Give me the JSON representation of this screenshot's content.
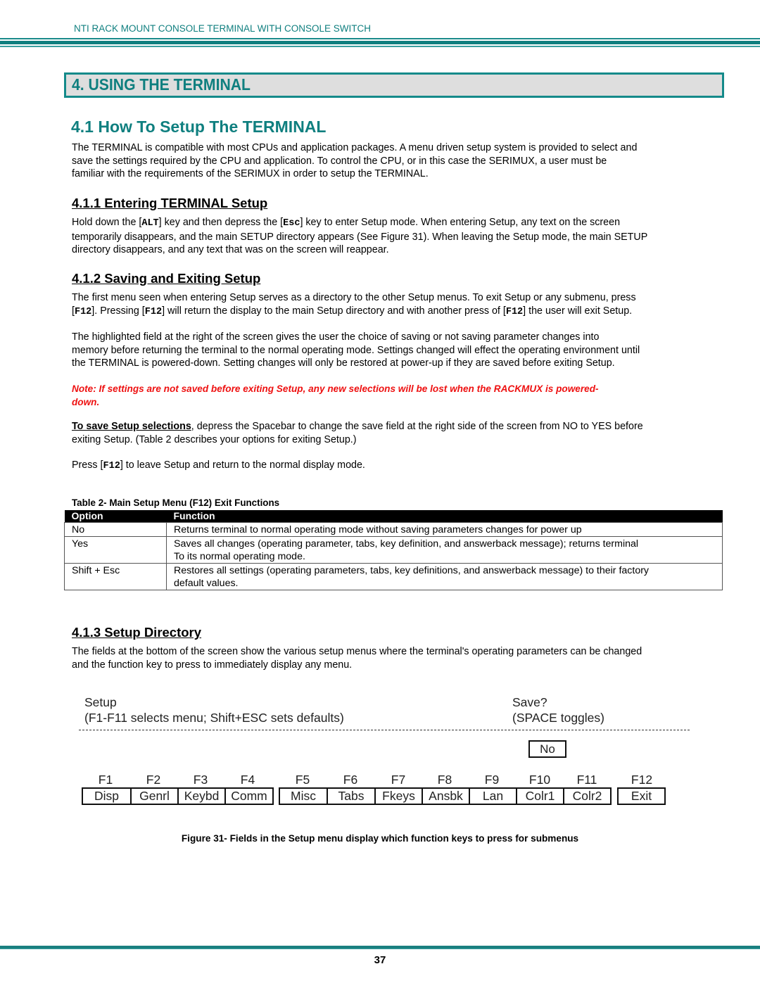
{
  "running_header": "NTI RACK MOUNT CONSOLE TERMINAL WITH CONSOLE SWITCH",
  "chapter_title": "4. USING THE TERMINAL",
  "section_4_1": {
    "title": "4.1 How To Setup The TERMINAL",
    "body": [
      "The TERMINAL is compatible with most CPUs and application packages. A menu driven setup system is provided to select and",
      "save the settings required by the CPU and application.   To control the CPU,  or in this case the SERIMUX, a user must be",
      "familiar with the requirements of the SERIMUX in order to setup the TERMINAL."
    ]
  },
  "section_4_1_1": {
    "title": "4.1.1 Entering TERMINAL Setup",
    "line1_a": "Hold down the [",
    "key_alt": "ALT",
    "line1_b": "] key and then depress the [",
    "key_esc": "Esc",
    "line1_c": "] key to enter Setup mode.  When entering Setup, any text on the screen",
    "line2": "temporarily disappears, and the main SETUP directory appears (See Figure 31). When leaving the Setup mode, the main SETUP",
    "line3": "directory disappears, and any text that was on the screen will reappear."
  },
  "section_4_1_2": {
    "title": "4.1.2 Saving and Exiting Setup",
    "p1_line1": "The first menu seen when entering Setup serves as a directory to the other Setup menus. To exit Setup or any submenu, press",
    "key_f12": "F12",
    "p1_line2_a": "[",
    "p1_line2_b": "].   Pressing [",
    "p1_line2_c": "] will return the display to the main Setup directory and with another press of [",
    "p1_line2_d": "] the user will exit  Setup.",
    "p2": [
      "The highlighted field at the right of the screen gives the user the choice of saving or not saving parameter changes into",
      "memory before returning the terminal to the normal operating mode.    Settings changed will effect the operating environment until",
      "the TERMINAL is powered-down. Setting changes will only be restored at power-up if  they are saved before exiting Setup."
    ],
    "note": [
      "Note:  If settings are not saved before exiting Setup, any new selections will be lost when the RACKMUX is powered-",
      "down."
    ],
    "save_lead": "To save Setup selections",
    "save_rest_line1": ", depress the Spacebar to change the save field at the right side of the screen from NO to YES before",
    "save_line2": "exiting Setup. (Table 2 describes your options for exiting Setup.)",
    "press_a": "Press [",
    "press_b": "] to leave Setup and return to the normal display mode."
  },
  "table2": {
    "caption": "Table 2- Main Setup Menu (F12) Exit Functions",
    "headers": [
      "Option",
      "Function"
    ],
    "rows": [
      {
        "option": "No",
        "function": [
          "Returns terminal to normal operating mode without saving parameters changes for power up"
        ]
      },
      {
        "option": "Yes",
        "function": [
          "Saves all changes (operating parameter, tabs, key definition, and answerback message); returns terminal",
          "To its normal operating mode."
        ]
      },
      {
        "option": "Shift + Esc",
        "function": [
          "Restores all settings (operating parameters, tabs, key definitions, and answerback message) to their factory",
          "default values."
        ]
      }
    ]
  },
  "section_4_1_3": {
    "title": "4.1.3 Setup Directory",
    "body": [
      "The fields at the bottom of the screen show the various setup menus where the terminal's operating parameters can be changed",
      "and the function key to press to immediately display any menu."
    ]
  },
  "figure31": {
    "setup_title": "Setup",
    "setup_hint": "(F1-F11 selects menu; Shift+ESC sets defaults)",
    "save_title": "Save?",
    "save_hint": "(SPACE toggles)",
    "save_value": "No",
    "keys": [
      {
        "fkey": "F1",
        "menu": "Disp"
      },
      {
        "fkey": "F2",
        "menu": "Genrl"
      },
      {
        "fkey": "F3",
        "menu": "Keybd"
      },
      {
        "fkey": "F4",
        "menu": "Comm"
      },
      {
        "fkey": "F5",
        "menu": "Misc"
      },
      {
        "fkey": "F6",
        "menu": "Tabs"
      },
      {
        "fkey": "F7",
        "menu": "Fkeys"
      },
      {
        "fkey": "F8",
        "menu": "Ansbk"
      },
      {
        "fkey": "F9",
        "menu": "Lan"
      },
      {
        "fkey": "F10",
        "menu": "Colr1"
      },
      {
        "fkey": "F11",
        "menu": "Colr2"
      },
      {
        "fkey": "F12",
        "menu": "Exit"
      }
    ],
    "caption": "Figure 31- Fields in the Setup menu display which function keys to press for submenus"
  },
  "page_number": "37"
}
